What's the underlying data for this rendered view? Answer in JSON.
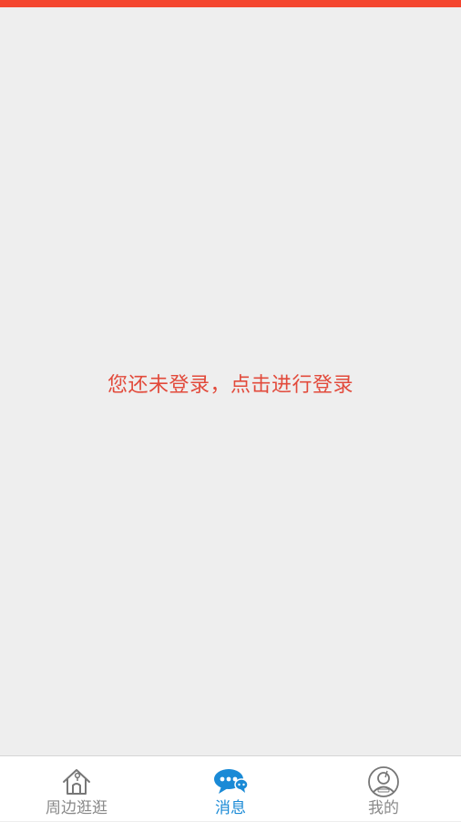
{
  "colors": {
    "accent_red": "#f4462f",
    "prompt_red": "#e24a3b",
    "tab_active": "#1a8ad6",
    "tab_inactive": "#8a8a8a",
    "background": "#eeeeee"
  },
  "main": {
    "login_prompt": "您还未登录，点击进行登录"
  },
  "tabbar": {
    "tabs": [
      {
        "label": "周边逛逛",
        "icon": "home-icon",
        "active": false
      },
      {
        "label": "消息",
        "icon": "chat-bubble-icon",
        "active": true
      },
      {
        "label": "我的",
        "icon": "user-avatar-icon",
        "active": false
      }
    ]
  }
}
